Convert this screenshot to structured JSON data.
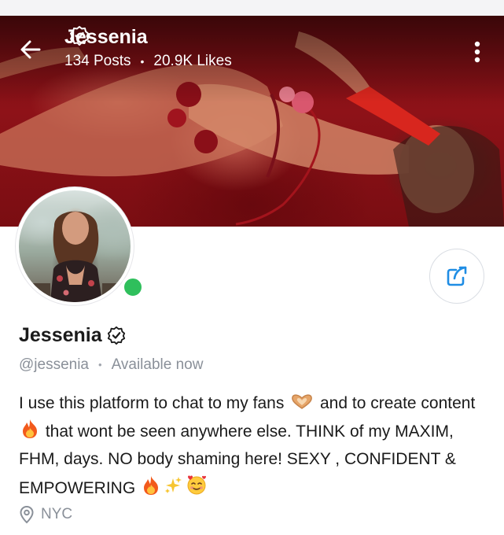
{
  "header": {
    "name": "Jessenia",
    "posts": "134 Posts",
    "separator": "•",
    "likes": "20.9K Likes"
  },
  "icons": {
    "back": "arrow-left-icon",
    "more": "more-vertical-icon",
    "verified": "verified-badge-icon",
    "share": "share-icon",
    "location": "location-pin-icon",
    "online": "online-status-dot",
    "bio_emojis": [
      "heart-hands-emoji",
      "fire-emoji",
      "fire-emoji",
      "sparkles-emoji",
      "smiling-face-with-hearts-emoji"
    ]
  },
  "colors": {
    "online": "#2fbf5c",
    "accent": "#1f8de4",
    "muted_text": "#8a9099"
  },
  "profile": {
    "name": "Jessenia",
    "handle": "@jessenia",
    "separator": "•",
    "status": "Available now",
    "bio": {
      "part1": "I use this platform to chat to my fans",
      "part2": "and to create content",
      "part3": "that wont be seen anywhere else. THINK of my MAXIM, FHM, days. NO body shaming here! SEXY , CONFIDENT & EMPOWERING"
    },
    "location": "NYC"
  }
}
